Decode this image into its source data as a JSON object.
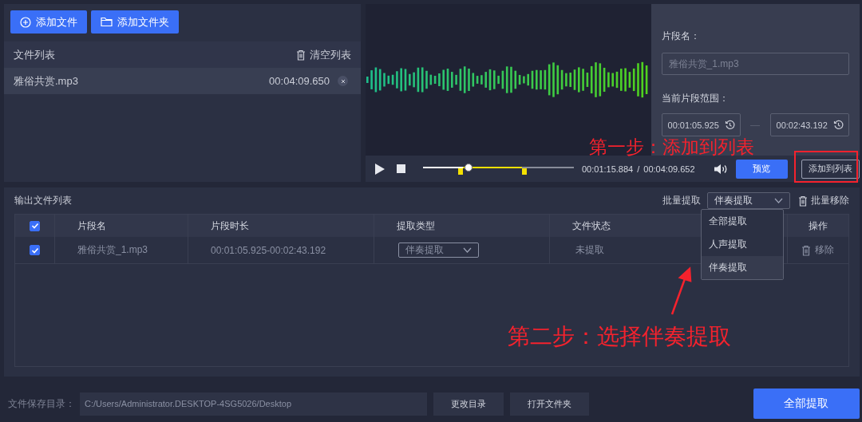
{
  "file_panel": {
    "buttons": [
      {
        "kind": "add_file",
        "label": "添加文件"
      },
      {
        "kind": "add_folder",
        "label": "添加文件夹"
      }
    ],
    "list_title": "文件列表",
    "clear_button": "清空列表",
    "files": [
      {
        "name": "雅俗共赏.mp3",
        "duration": "00:04:09.650",
        "selected": true
      }
    ]
  },
  "player": {
    "segment_name_label": "片段名：",
    "segment_name_placeholder": "雅俗共赏_1.mp3",
    "range_label": "当前片段范围：",
    "range_start": "00:01:05.925",
    "range_separator": "—",
    "range_end": "00:02:43.192",
    "current_time": "00:01:15.884",
    "time_separator": "/",
    "total_time": "00:04:09.652",
    "level": 0.3,
    "preview_button": "预览",
    "add_button": "添加到列表"
  },
  "output": {
    "title": "输出文件列表",
    "batch_label": "批量提取",
    "batch_select": {
      "value": "伴奏提取",
      "expanded": true,
      "options": [
        {
          "label": "全部提取",
          "selected": false
        },
        {
          "label": "人声提取",
          "selected": false
        },
        {
          "label": "伴奏提取",
          "selected": true
        }
      ]
    },
    "batch_remove": "批量移除",
    "header_checked": true,
    "columns": [
      "片段名",
      "片段时长",
      "提取类型",
      "文件状态",
      "操作"
    ],
    "rows": [
      {
        "checked": true,
        "name": "雅俗共赏_1.mp3",
        "duration": "00:01:05.925-00:02:43.192",
        "type": "伴奏提取",
        "status": "未提取",
        "action": "移除"
      }
    ]
  },
  "footer": {
    "dir_label": "文件保存目录：",
    "dir_value": "C:/Users/Administrator.DESKTOP-4SG5026/Desktop",
    "buttons": [
      "更改目录",
      "打开文件夹"
    ],
    "extract_all": "全部提取"
  },
  "annotations": {
    "step_one": "第一步：添加到列表",
    "step_two": "第二步：选择伴奏提取"
  }
}
